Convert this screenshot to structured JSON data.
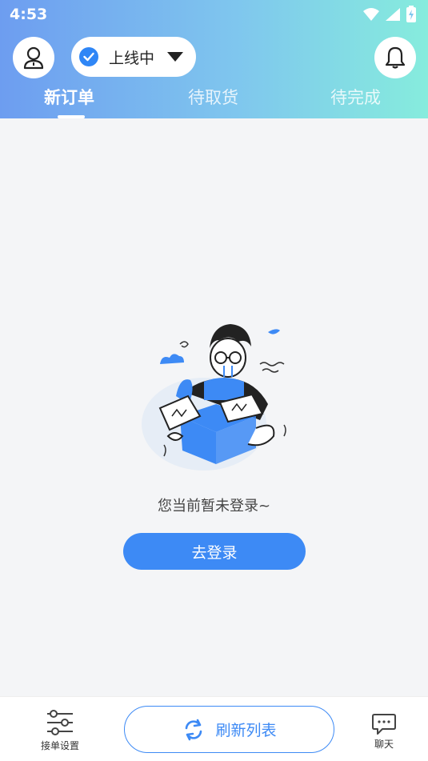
{
  "status_bar": {
    "time": "4:53"
  },
  "header": {
    "online_status": "上线中",
    "tabs": [
      {
        "label": "新订单",
        "active": true
      },
      {
        "label": "待取货",
        "active": false
      },
      {
        "label": "待完成",
        "active": false
      }
    ]
  },
  "empty_state": {
    "message": "您当前暂未登录~",
    "login_button": "去登录"
  },
  "bottom_bar": {
    "order_settings_label": "接单设置",
    "refresh_label": "刷新列表",
    "chat_label": "聊天"
  },
  "colors": {
    "accent": "#3d8af5",
    "header_gradient_start": "#6d9df0",
    "header_gradient_end": "#86ecdd",
    "background": "#f4f5f7"
  },
  "icons": [
    "user-icon",
    "check-icon",
    "caret-down-icon",
    "bell-icon",
    "refresh-icon",
    "sliders-icon",
    "chat-icon",
    "wifi-icon",
    "signal-icon",
    "battery-icon"
  ]
}
